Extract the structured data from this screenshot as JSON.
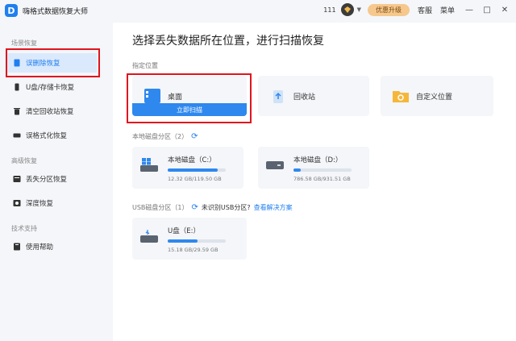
{
  "app": {
    "title": "嗨格式数据恢复大师",
    "logo_letter": "D"
  },
  "titlebar": {
    "user_num": "111",
    "upgrade": "优惠升级",
    "service": "客服",
    "menu": "菜单",
    "minimize": "—",
    "maximize": "□",
    "close": "✕",
    "caret": "▼"
  },
  "sidebar": {
    "section_scene": "场景恢复",
    "section_advanced": "高级恢复",
    "section_support": "技术支持",
    "items": [
      {
        "label": "误删除恢复"
      },
      {
        "label": "U盘/存储卡恢复"
      },
      {
        "label": "清空回收站恢复"
      },
      {
        "label": "误格式化恢复"
      },
      {
        "label": "丢失分区恢复"
      },
      {
        "label": "深度恢复"
      },
      {
        "label": "使用帮助"
      }
    ]
  },
  "main": {
    "title": "选择丢失数据所在位置，进行扫描恢复",
    "locations_label": "指定位置",
    "locations": [
      {
        "label": "桌面",
        "scan": "立即扫描"
      },
      {
        "label": "回收站"
      },
      {
        "label": "自定义位置"
      }
    ],
    "local_label": "本地磁盘分区（2）",
    "local_disks": [
      {
        "name": "本地磁盘（C:）",
        "size": "12.32 GB/119.50 GB",
        "fill": 0.86
      },
      {
        "name": "本地磁盘（D:）",
        "size": "786.58 GB/931.51 GB",
        "fill": 0.12
      }
    ],
    "usb_label": "USB磁盘分区（1）",
    "usb_unknown": "未识别USB分区?",
    "usb_help": "查看解决方案",
    "usb_disks": [
      {
        "name": "U盘（E:）",
        "size": "15.18 GB/29.59 GB",
        "fill": 0.52
      }
    ]
  },
  "colors": {
    "accent": "#1f7ff0",
    "highlight": "#e0141e",
    "upgrade": "#f6c88d"
  }
}
